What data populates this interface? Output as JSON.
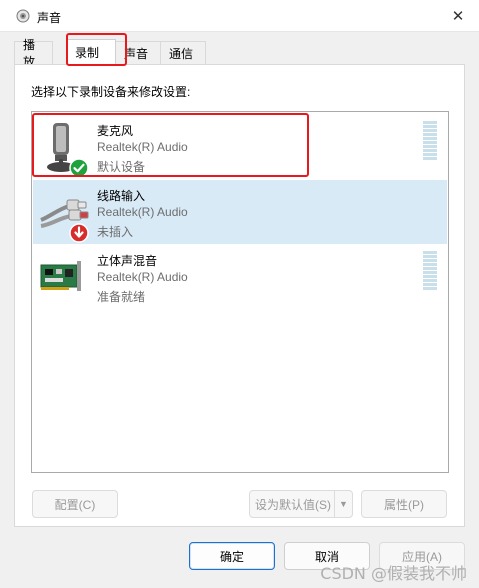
{
  "window": {
    "title": "声音",
    "close_glyph": "✕"
  },
  "tabs": [
    {
      "label": "播放"
    },
    {
      "label": "录制"
    },
    {
      "label": "声音"
    },
    {
      "label": "通信"
    }
  ],
  "active_tab": "录制",
  "panel": {
    "instruction": "选择以下录制设备来修改设置:"
  },
  "devices": [
    {
      "name": "麦克风",
      "driver": "Realtek(R) Audio",
      "status": "默认设备",
      "icon": "microphone-icon",
      "badge": "default-check-icon",
      "meter_level": 0
    },
    {
      "name": "线路输入",
      "driver": "Realtek(R) Audio",
      "status": "未插入",
      "icon": "line-in-cable-icon",
      "badge": "unplugged-arrow-icon"
    },
    {
      "name": "立体声混音",
      "driver": "Realtek(R) Audio",
      "status": "准备就绪",
      "icon": "sound-card-icon",
      "meter_level": 0
    }
  ],
  "buttons": {
    "configure": "配置(C)",
    "set_default": "设为默认值(S)",
    "properties": "属性(P)",
    "ok": "确定",
    "cancel": "取消",
    "apply": "应用(A)"
  },
  "watermark": "CSDN @假装我不帅",
  "colors": {
    "highlight_red": "#e8191c",
    "selection_blue": "#d9eaf7",
    "meter": "#c9dfe9",
    "primary_border": "#1f6fcf"
  }
}
